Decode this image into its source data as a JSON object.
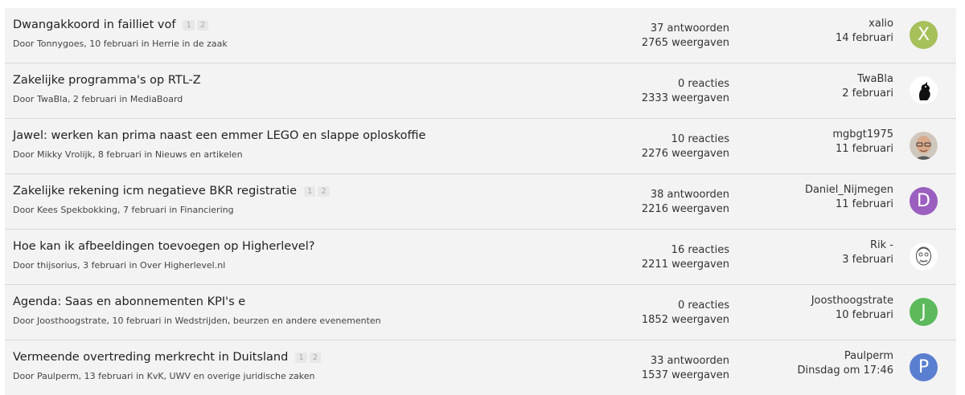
{
  "topics": [
    {
      "title": "Dwangakkoord in failliet vof",
      "pages": [
        "1",
        "2"
      ],
      "meta": {
        "prefix": "Door ",
        "author": "Tonnygoes",
        "date": ", 10 februari in ",
        "forum": "Herrie in de zaak"
      },
      "replies": "37 antwoorden",
      "views": "2765 weergaven",
      "last_user": "xalio",
      "last_date": "14 februari",
      "avatar_letter": "X",
      "avatar_color": "#a6c05a"
    },
    {
      "title": "Zakelijke programma's op RTL-Z",
      "pages": [],
      "meta": {
        "prefix": "Door ",
        "author": "TwaBla",
        "date": ", 2 februari in ",
        "forum": "MediaBoard"
      },
      "replies": "0 reacties",
      "views": "2333 weergaven",
      "last_user": "TwaBla",
      "last_date": "2 februari",
      "avatar_icon": "bird-silhouette-avatar"
    },
    {
      "title": "Jawel: werken kan prima naast een emmer LEGO en slappe oploskoffie",
      "pages": [],
      "meta": {
        "prefix": "Door ",
        "author": "Mikky Vrolijk",
        "date": ", 8 februari in ",
        "forum": "Nieuws en artikelen"
      },
      "replies": "10 reacties",
      "views": "2276 weergaven",
      "last_user": "mgbgt1975",
      "last_date": "11 februari",
      "avatar_icon": "face-photo-avatar"
    },
    {
      "title": "Zakelijke rekening icm negatieve BKR registratie",
      "pages": [
        "1",
        "2"
      ],
      "meta": {
        "prefix": "Door ",
        "author": "Kees Spekbokking",
        "date": ", 7 februari in ",
        "forum": "Financiering"
      },
      "replies": "38 antwoorden",
      "views": "2216 weergaven",
      "last_user": "Daniel_Nijmegen",
      "last_date": "11 februari",
      "avatar_letter": "D",
      "avatar_color": "#9b5fc0"
    },
    {
      "title": "Hoe kan ik afbeeldingen toevoegen op Higherlevel?",
      "pages": [],
      "meta": {
        "prefix": "Door ",
        "author": "thijsorius",
        "date": ", 3 februari in ",
        "forum": "Over Higherlevel.nl"
      },
      "replies": "16 reacties",
      "views": "2211 weergaven",
      "last_user": "Rik -",
      "last_date": "3 februari",
      "avatar_icon": "sketch-face-avatar"
    },
    {
      "title": "Agenda: Saas en abonnementen KPI's e",
      "pages": [],
      "meta": {
        "prefix": "Door ",
        "author": "Joosthoogstrate",
        "date": ", 10 februari in ",
        "forum": "Wedstrijden, beurzen en andere evenementen"
      },
      "replies": "0 reacties",
      "views": "1852 weergaven",
      "last_user": "Joosthoogstrate",
      "last_date": "10 februari",
      "avatar_letter": "J",
      "avatar_color": "#5cba5c"
    },
    {
      "title": "Vermeende overtreding merkrecht in Duitsland",
      "pages": [
        "1",
        "2"
      ],
      "meta": {
        "prefix": "Door ",
        "author": "Paulperm",
        "date": ", 13 februari in ",
        "forum": "KvK, UWV en overige juridische zaken"
      },
      "replies": "33 antwoorden",
      "views": "1537 weergaven",
      "last_user": "Paulperm",
      "last_date": "Dinsdag om 17:46",
      "avatar_letter": "P",
      "avatar_color": "#5b7fd0"
    }
  ]
}
